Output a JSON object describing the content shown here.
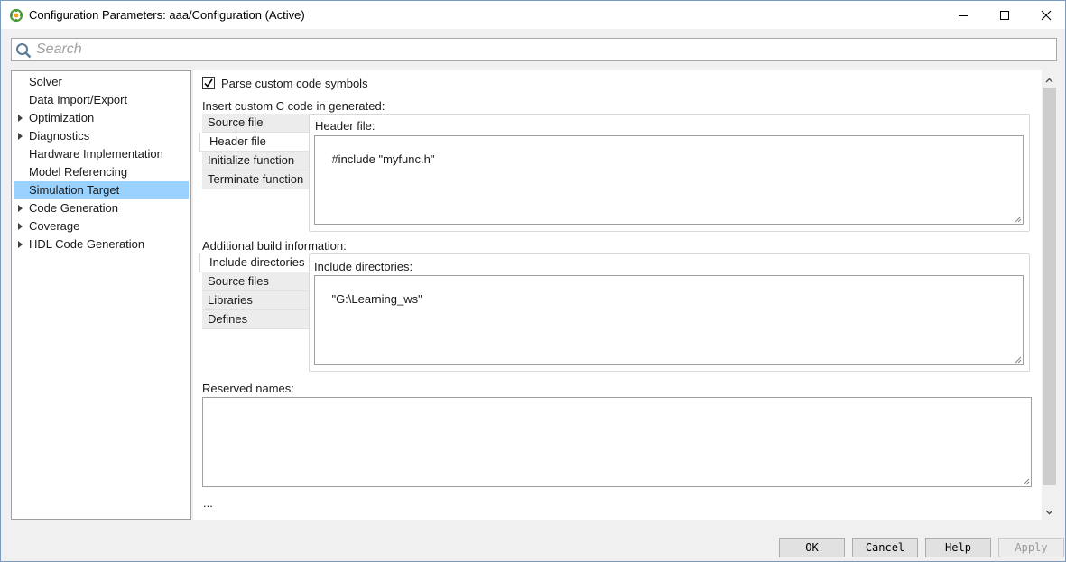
{
  "window": {
    "title": "Configuration Parameters: aaa/Configuration (Active)",
    "controls": [
      "minimize",
      "maximize",
      "close"
    ]
  },
  "search": {
    "placeholder": "Search",
    "value": ""
  },
  "tree": {
    "items": [
      {
        "label": "Solver",
        "expandable": false,
        "selected": false
      },
      {
        "label": "Data Import/Export",
        "expandable": false,
        "selected": false
      },
      {
        "label": "Optimization",
        "expandable": true,
        "selected": false
      },
      {
        "label": "Diagnostics",
        "expandable": true,
        "selected": false
      },
      {
        "label": "Hardware Implementation",
        "expandable": false,
        "selected": false
      },
      {
        "label": "Model Referencing",
        "expandable": false,
        "selected": false
      },
      {
        "label": "Simulation Target",
        "expandable": false,
        "selected": true
      },
      {
        "label": "Code Generation",
        "expandable": true,
        "selected": false
      },
      {
        "label": "Coverage",
        "expandable": true,
        "selected": false
      },
      {
        "label": "HDL Code Generation",
        "expandable": true,
        "selected": false
      }
    ]
  },
  "content": {
    "parse_checkbox": {
      "label": "Parse custom code symbols",
      "checked": true
    },
    "custom_code": {
      "section_label": "Insert custom C code in generated:",
      "tabs": [
        "Source file",
        "Header file",
        "Initialize function",
        "Terminate function"
      ],
      "active_tab": "Header file",
      "panel_label": "Header file:",
      "value": "#include \"myfunc.h\""
    },
    "build_info": {
      "section_label": "Additional build information:",
      "tabs": [
        "Include directories",
        "Source files",
        "Libraries",
        "Defines"
      ],
      "active_tab": "Include directories",
      "panel_label": "Include directories:",
      "value": "\"G:\\Learning_ws\""
    },
    "reserved_names": {
      "label": "Reserved names:",
      "value": ""
    },
    "more": "..."
  },
  "buttons": {
    "ok": "OK",
    "cancel": "Cancel",
    "help": "Help",
    "apply": "Apply"
  },
  "colors": {
    "selection": "#99d1ff",
    "accent": "#0078d7"
  }
}
